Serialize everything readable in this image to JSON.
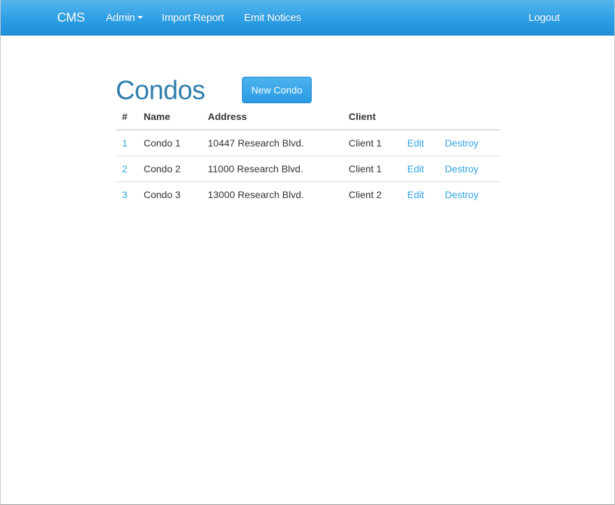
{
  "navbar": {
    "brand": "CMS",
    "admin_label": "Admin",
    "import_label": "Import Report",
    "emit_label": "Emit Notices",
    "logout_label": "Logout"
  },
  "main": {
    "title": "Condos",
    "new_button_label": "New Condo"
  },
  "table": {
    "headers": [
      "#",
      "Name",
      "Address",
      "Client"
    ],
    "rows": [
      {
        "id": "1",
        "name": "Condo 1",
        "address": "10447 Research Blvd.",
        "client": "Client 1",
        "edit": "Edit",
        "destroy": "Destroy"
      },
      {
        "id": "2",
        "name": "Condo 2",
        "address": "11000 Research Blvd.",
        "client": "Client 1",
        "edit": "Edit",
        "destroy": "Destroy"
      },
      {
        "id": "3",
        "name": "Condo 3",
        "address": "13000 Research Blvd.",
        "client": "Client 2",
        "edit": "Edit",
        "destroy": "Destroy"
      }
    ]
  },
  "colors": {
    "navbar": "#2d9fe4",
    "title": "#317eac",
    "link": "#2fa4e7",
    "button": "#2a9be2"
  },
  "icons": {
    "admin_dropdown": "caret-down-icon"
  }
}
